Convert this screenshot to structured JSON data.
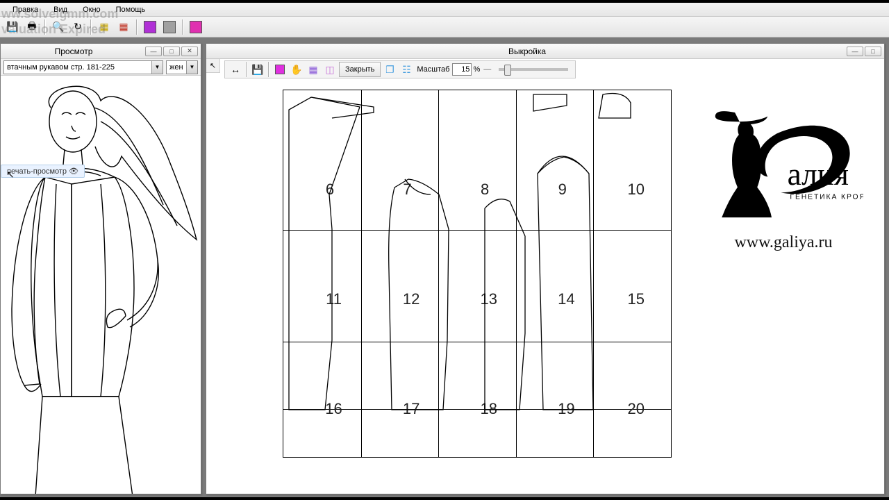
{
  "watermark": {
    "line1": "ww.solveigmm.com",
    "line2": "valuation Expired"
  },
  "menubar": {
    "items": [
      "Правка",
      "Вид",
      "Окно",
      "Помощь"
    ]
  },
  "main_toolbar": {
    "swatches": [
      "#b030d6",
      "#a0a0a0"
    ],
    "swatch_extra": "#e030b0"
  },
  "preview": {
    "title": "Просмотр",
    "dropdown_model": "втачным рукавом стр. 181-225",
    "dropdown_gender": "жен",
    "tooltip": "печать-просмотр"
  },
  "pattern": {
    "title": "Выкройка",
    "close_label": "Закрыть",
    "scale_label": "Масштаб",
    "scale_value": "15",
    "percent": "%",
    "swatch": "#e030e0",
    "grid": {
      "cols": 5,
      "rows": 4,
      "numbers": [
        [
          "6",
          "7",
          "8",
          "9",
          "10"
        ],
        [
          "11",
          "12",
          "13",
          "14",
          "15"
        ],
        [
          "16",
          "17",
          "18",
          "19",
          "20"
        ]
      ]
    }
  },
  "logo": {
    "script": "алия",
    "tagline": "ГЕНЕТИКА КРОЯ",
    "url": "www.galiya.ru"
  }
}
